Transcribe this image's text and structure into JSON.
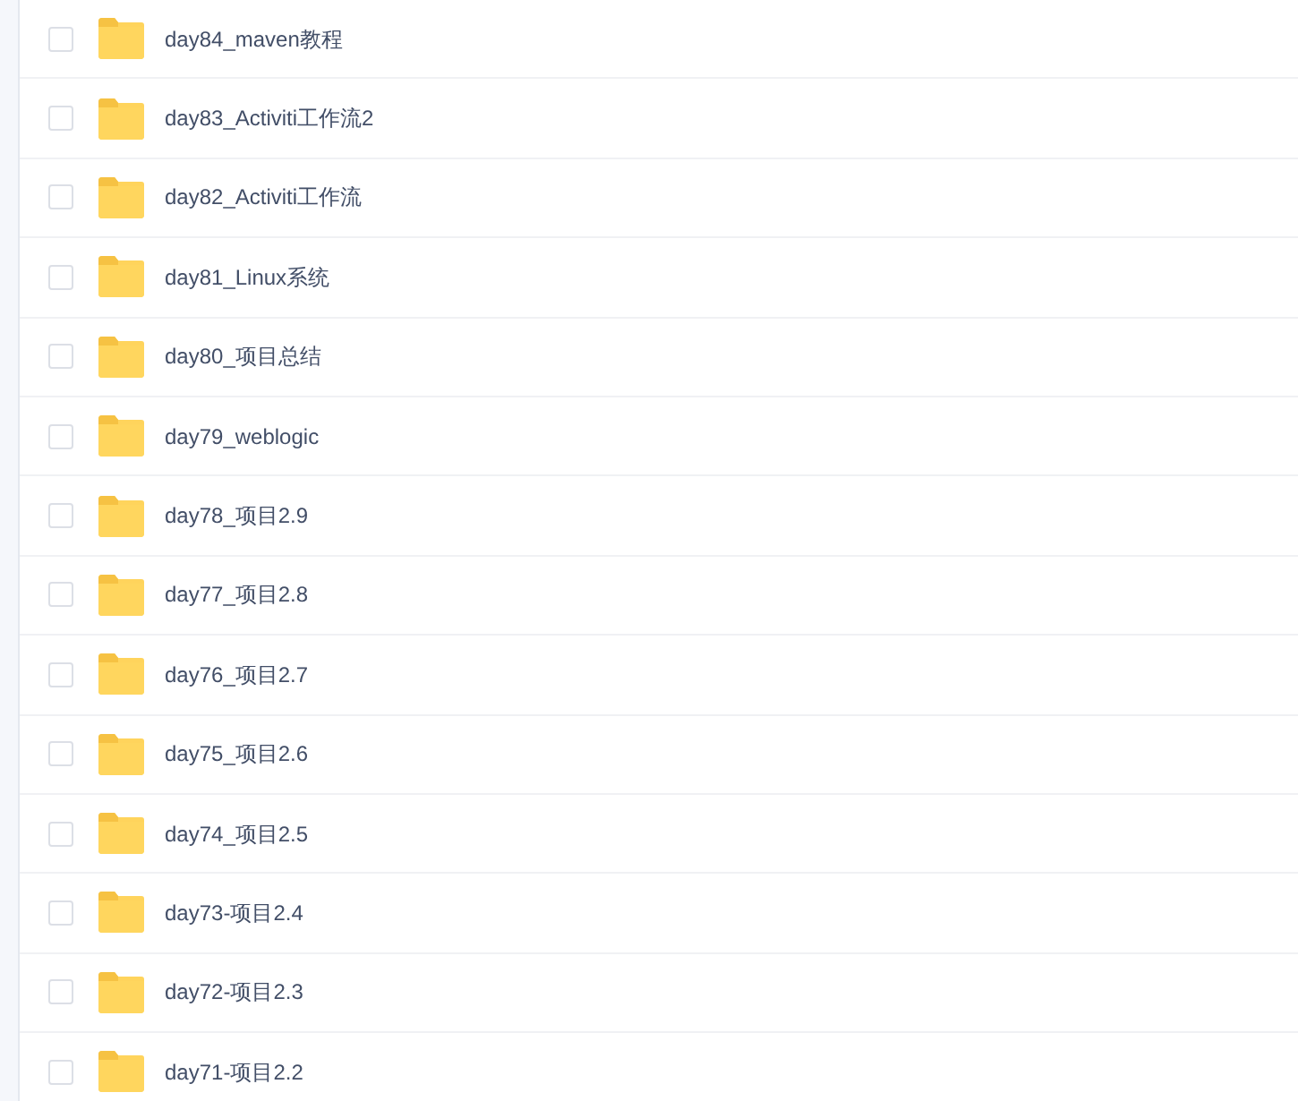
{
  "files": [
    {
      "name": "day84_maven教程",
      "checked": false
    },
    {
      "name": "day83_Activiti工作流2",
      "checked": false
    },
    {
      "name": "day82_Activiti工作流",
      "checked": false
    },
    {
      "name": "day81_Linux系统",
      "checked": false
    },
    {
      "name": "day80_项目总结",
      "checked": false
    },
    {
      "name": "day79_weblogic",
      "checked": false
    },
    {
      "name": "day78_项目2.9",
      "checked": false
    },
    {
      "name": "day77_项目2.8",
      "checked": false
    },
    {
      "name": "day76_项目2.7",
      "checked": false
    },
    {
      "name": "day75_项目2.6",
      "checked": false
    },
    {
      "name": "day74_项目2.5",
      "checked": false
    },
    {
      "name": "day73-项目2.4",
      "checked": false
    },
    {
      "name": "day72-项目2.3",
      "checked": false
    },
    {
      "name": "day71-项目2.2",
      "checked": false
    }
  ]
}
